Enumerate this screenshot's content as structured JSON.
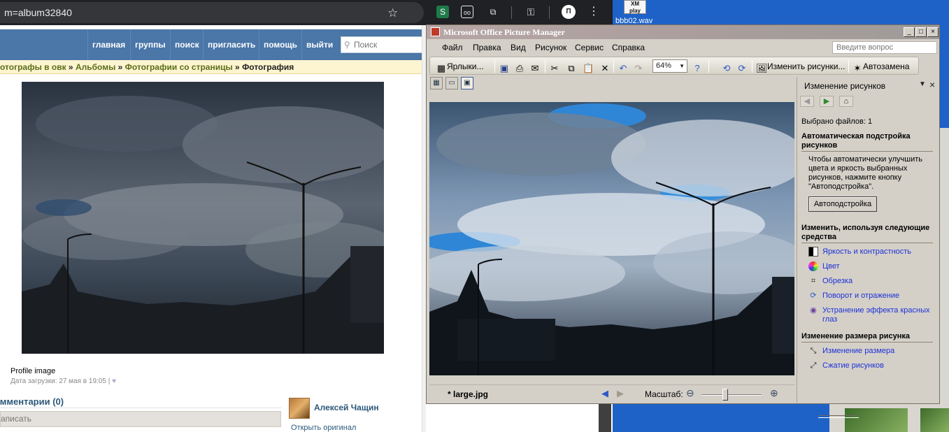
{
  "browser": {
    "url": "m=album32840"
  },
  "vk": {
    "nav": [
      "главная",
      "группы",
      "поиск",
      "пригласить",
      "помощь",
      "выйти"
    ],
    "search_placeholder": "Поиск",
    "breadcrumb": {
      "part1": "отографы в овк",
      "sep": " » ",
      "part2": "Альбомы",
      "part3": "Фотографии со страницы",
      "current": "Фотография"
    },
    "photo_title": "Profile image",
    "upload_date": "Дата загрузки: 27 мая в 19:05 |",
    "comments_title": "омментарии (0)",
    "write_placeholder": "аписать",
    "author": "Алексей Чащин",
    "open_original": "Открыть оригинал"
  },
  "desktop": {
    "icon_text": "XM play",
    "icon_label": "bbb02.wav"
  },
  "picture_manager": {
    "title": "Microsoft Office Picture Manager",
    "window_buttons": [
      "_",
      "□",
      "×"
    ],
    "menu": [
      "Файл",
      "Правка",
      "Вид",
      "Рисунок",
      "Сервис",
      "Справка"
    ],
    "ask_placeholder": "Введите вопрос",
    "toolbar": {
      "shortcuts": "Ярлыки...",
      "zoom": "64%",
      "edit_pictures": "Изменить рисунки...",
      "autoreplace": "Автозамена"
    },
    "status": {
      "file": "* large.jpg",
      "scale_label": "Масштаб:",
      "zoom_level": 0.4
    },
    "task_pane": {
      "title": "Изменение рисунков",
      "selected": "Выбрано файлов: 1",
      "section_auto": "Автоматическая подстройка рисунков",
      "auto_desc": "Чтобы автоматически улучшить цвета и яркость выбранных рисунков, нажмите кнопку \"Автоподстройка\".",
      "autofix_button": "Автоподстройка",
      "section_tools": "Изменить, используя следующие средства",
      "tools": [
        "Яркость и контрастность",
        "Цвет",
        "Обрезка",
        "Поворот и отражение",
        "Устранение эффекта красных глаз"
      ],
      "section_resize": "Изменение размера рисунка",
      "resize_tools": [
        "Изменение размера",
        "Сжатие рисунков"
      ]
    }
  }
}
